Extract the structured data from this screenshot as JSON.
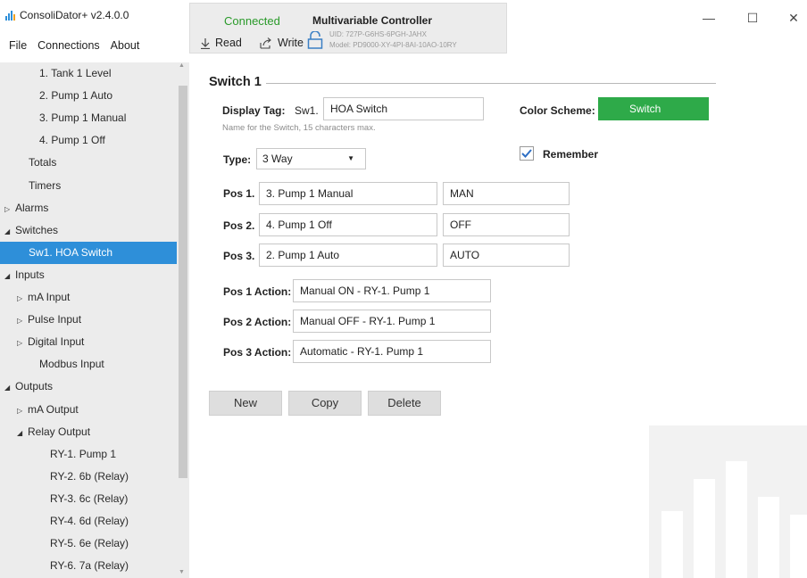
{
  "app": {
    "title": "ConsoliDator+ v2.4.0.0"
  },
  "menu": [
    "File",
    "Connections",
    "About"
  ],
  "connection": {
    "status": "Connected",
    "read_label": "Read",
    "write_label": "Write",
    "device_title": "Multivariable Controller",
    "uid": "UID: 727P-G6HS-6PGH-JAHX",
    "model": "Model: PD9000-XY-4PI-8AI-10AO-10RY"
  },
  "window_controls": {
    "minimize": "—",
    "maximize": "☐",
    "close": "✕"
  },
  "sidebar": {
    "items": [
      {
        "label": "1. Tank 1 Level",
        "indent": 2,
        "arrow": ""
      },
      {
        "label": "2. Pump 1 Auto",
        "indent": 2,
        "arrow": ""
      },
      {
        "label": "3. Pump 1 Manual",
        "indent": 2,
        "arrow": ""
      },
      {
        "label": "4. Pump 1 Off",
        "indent": 2,
        "arrow": ""
      },
      {
        "label": "Totals",
        "indent": 1,
        "arrow": ""
      },
      {
        "label": "Timers",
        "indent": 1,
        "arrow": ""
      },
      {
        "label": "Alarms",
        "indent": 0,
        "arrow": "▷"
      },
      {
        "label": "Switches",
        "indent": 0,
        "arrow": "◢"
      },
      {
        "label": "Sw1. HOA Switch",
        "indent": 2,
        "arrow": "",
        "selected": true
      },
      {
        "label": "Inputs",
        "indent": 0,
        "arrow": "◢"
      },
      {
        "label": "mA Input",
        "indent": 1,
        "arrow": "▷"
      },
      {
        "label": "Pulse Input",
        "indent": 1,
        "arrow": "▷"
      },
      {
        "label": "Digital Input",
        "indent": 1,
        "arrow": "▷"
      },
      {
        "label": "Modbus Input",
        "indent": 2,
        "arrow": ""
      },
      {
        "label": "Outputs",
        "indent": 0,
        "arrow": "◢"
      },
      {
        "label": "mA Output",
        "indent": 1,
        "arrow": "▷"
      },
      {
        "label": "Relay Output",
        "indent": 1,
        "arrow": "◢"
      },
      {
        "label": "RY-1. Pump 1",
        "indent": 3,
        "arrow": ""
      },
      {
        "label": "RY-2. 6b (Relay)",
        "indent": 3,
        "arrow": ""
      },
      {
        "label": "RY-3. 6c (Relay)",
        "indent": 3,
        "arrow": ""
      },
      {
        "label": "RY-4. 6d (Relay)",
        "indent": 3,
        "arrow": ""
      },
      {
        "label": "RY-5. 6e (Relay)",
        "indent": 3,
        "arrow": ""
      },
      {
        "label": "RY-6. 7a (Relay)",
        "indent": 3,
        "arrow": ""
      }
    ]
  },
  "form": {
    "section_title": "Switch 1",
    "display_tag_label": "Display Tag:",
    "display_tag_prefix": "Sw1.",
    "display_tag_value": "HOA Switch",
    "display_tag_hint": "Name for the Switch, 15 characters max.",
    "color_scheme_label": "Color Scheme:",
    "color_scheme_value": "Switch",
    "color_scheme_color": "#2eaa49",
    "remember_label": "Remember",
    "remember_checked": true,
    "type_label": "Type:",
    "type_value": "3 Way",
    "positions": [
      {
        "label": "Pos 1.",
        "value": "3. Pump 1 Manual",
        "tag": "MAN"
      },
      {
        "label": "Pos 2.",
        "value": "4. Pump 1 Off",
        "tag": "OFF"
      },
      {
        "label": "Pos 3.",
        "value": "2. Pump 1 Auto",
        "tag": "AUTO"
      }
    ],
    "actions": [
      {
        "label": "Pos 1 Action:",
        "value": "Manual ON - RY-1. Pump 1"
      },
      {
        "label": "Pos 2 Action:",
        "value": "Manual OFF - RY-1. Pump 1"
      },
      {
        "label": "Pos 3 Action:",
        "value": "Automatic - RY-1. Pump 1"
      }
    ],
    "buttons": {
      "new": "New",
      "copy": "Copy",
      "delete": "Delete"
    }
  }
}
